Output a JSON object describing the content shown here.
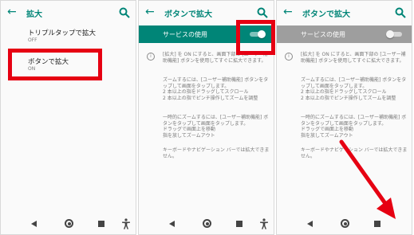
{
  "colors": {
    "accent": "#008577",
    "disabled_bar": "#9e9e9e",
    "highlight_red": "#e60012"
  },
  "panel1": {
    "title": "拡大",
    "items": [
      {
        "label": "トリプルタップで拡大",
        "status": "OFF"
      },
      {
        "label": "ボタンで拡大",
        "status": "ON"
      }
    ]
  },
  "panel2": {
    "title": "ボタンで拡大",
    "service_label": "サービスの使用",
    "toggle_state": "on",
    "paragraphs": [
      "[拡大] を ON にすると、画面下部の [ユーザー補助機能] ボタンを使用してすぐに拡大できます。",
      "ズームするには、[ユーザー補助機能] ボタンをタップして画面をタップします。\n2 本以上の指をドラッグしてスクロール\n2 本以上の指でピンチ操作してズームを調整",
      "一時的にズームするには、[ユーザー補助機能] ボタンをタップして画面をタップします。\nドラッグで画面上を移動\n指を放してズームアウト",
      "キーボードやナビゲーション バーでは拡大できません。"
    ]
  },
  "panel3": {
    "title": "ボタンで拡大",
    "service_label": "サービスの使用",
    "toggle_state": "off",
    "paragraphs": [
      "[拡大] を ON にすると、画面下部の [ユーザー補助機能] ボタンを使用してすぐに拡大できます。",
      "ズームするには、[ユーザー補助機能] ボタンをタップして画面をタップします。\n2 本以上の指をドラッグしてスクロール\n2 本以上の指でピンチ操作してズームを調整",
      "一時的にズームするには、[ユーザー補助機能] ボタンをタップして画面をタップします。\nドラッグで画面上を移動\n指を放してズームアウト",
      "キーボードやナビゲーション バーでは拡大できません。"
    ]
  },
  "icons": {
    "back": "arrow-back-icon",
    "search": "search-icon",
    "info": "info-icon",
    "nav_back": "nav-back-icon",
    "nav_home": "nav-home-icon",
    "nav_recent": "nav-recent-icon",
    "accessibility": "accessibility-icon"
  }
}
